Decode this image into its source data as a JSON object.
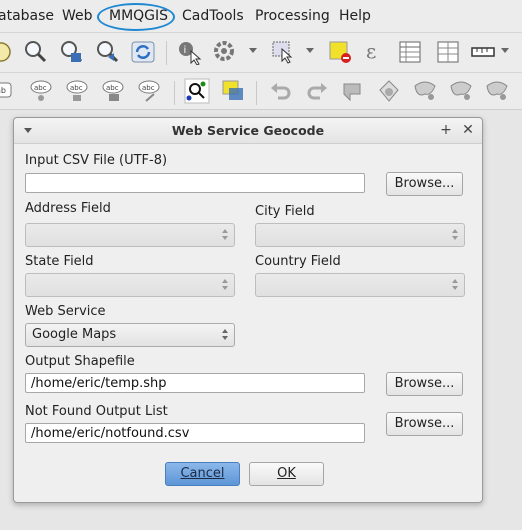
{
  "menubar": {
    "items": [
      "atabase",
      "Web",
      "MMQGIS",
      "CadTools",
      "Processing",
      "Help"
    ]
  },
  "toolbar1": {
    "icons": [
      "open-project-icon",
      "zoom-in-icon",
      "zoom-to-layer-icon",
      "zoom-last-icon",
      "refresh-icon",
      "identify-icon",
      "action-icon",
      "select-icon",
      "deselect-icon",
      "field-calculator-icon",
      "attribute-table-icon",
      "statistics-icon",
      "measure-icon"
    ]
  },
  "toolbar2": {
    "icons": [
      "label-icon",
      "label-pin-icon",
      "label-show-hide-icon",
      "label-move-icon",
      "label-rotate-icon",
      "label-change-icon",
      "georeferencer-icon",
      "highlight-icon",
      "undo-icon",
      "redo-icon",
      "digitize-icon",
      "edit-node-icon",
      "offset-icon",
      "split-icon",
      "merge-icon"
    ]
  },
  "dialog": {
    "title": "Web Service Geocode",
    "input_csv_label": "Input CSV File (UTF-8)",
    "input_csv_value": "",
    "browse_label": "Browse...",
    "address_label": "Address Field",
    "address_value": "",
    "city_label": "City Field",
    "city_value": "",
    "state_label": "State Field",
    "state_value": "",
    "country_label": "Country Field",
    "country_value": "",
    "web_service_label": "Web Service",
    "web_service_value": "Google Maps",
    "output_shapefile_label": "Output Shapefile",
    "output_shapefile_value": "/home/eric/temp.shp",
    "not_found_label": "Not Found Output List",
    "not_found_value": "/home/eric/notfound.csv",
    "cancel_label": "Cancel",
    "ok_label": "OK"
  },
  "colors": {
    "highlight_ring": "#1e88d2",
    "primary_button": "#6fa3dd"
  }
}
